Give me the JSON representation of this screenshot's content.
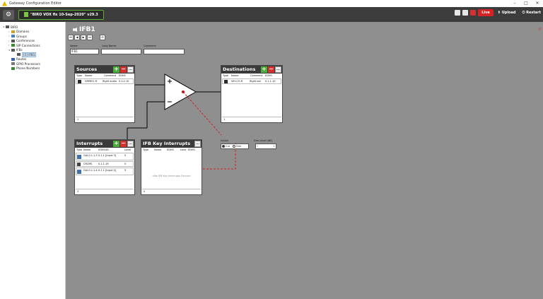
{
  "window": {
    "title": "Gateway Configuration Editor",
    "controls": [
      "–",
      "□",
      "✕"
    ]
  },
  "toolbar": {
    "file_label": "\"BIRO VOX fix 10-Sep-2020\"  v29.3",
    "live_label": "Live",
    "upload_label": "Upload",
    "restart_label": "Restart"
  },
  "tree": {
    "items": [
      {
        "label": "BIRO",
        "indent": 0,
        "icon": "system-icon",
        "color": "#555555"
      },
      {
        "label": "Domains",
        "indent": 1,
        "icon": "domains-icon",
        "color": "#c9a227"
      },
      {
        "label": "Groups",
        "indent": 1,
        "icon": "groups-icon",
        "color": "#4a7fbf"
      },
      {
        "label": "Conferences",
        "indent": 1,
        "icon": "conferences-icon",
        "color": "#555555"
      },
      {
        "label": "SIP Connections",
        "indent": 1,
        "icon": "sip-icon",
        "color": "#3a8a3a"
      },
      {
        "label": "IFBs",
        "indent": 1,
        "icon": "ifb-icon",
        "color": "#555555"
      },
      {
        "label": "[1] IFB1",
        "indent": 2,
        "icon": "ifb-item-icon",
        "color": "#555555",
        "selected": true
      },
      {
        "label": "Routes",
        "indent": 1,
        "icon": "routes-icon",
        "color": "#3a5fa8"
      },
      {
        "label": "GPIO Processors",
        "indent": 1,
        "icon": "gpio-icon",
        "color": "#777777"
      },
      {
        "label": "Phone Numbers",
        "indent": 1,
        "icon": "phone-icon",
        "color": "#3a8a3a"
      }
    ]
  },
  "page": {
    "title": "IFB1",
    "close": "✕",
    "nav": [
      "⏮",
      "◀",
      "▶",
      "⏭",
      " ",
      "⟳"
    ],
    "name_label": "Name:",
    "name_value": "IFB1",
    "long_name_label": "Long Name:",
    "long_name_value": "",
    "comment_label": "Comment:",
    "comment_value": ""
  },
  "sources": {
    "title": "Sources",
    "headers": [
      "Type",
      "Name",
      "Comment",
      "EDHS"
    ],
    "rows": [
      {
        "name": "VMMEO-R",
        "comment": "Right audio",
        "edhs": "0.1.2.10"
      }
    ],
    "count": "1"
  },
  "destinations": {
    "title": "Destinations",
    "headers": [
      "Type",
      "Name",
      "Comment",
      "EDHS"
    ],
    "rows": [
      {
        "name": "VIH-CO-R",
        "comment": "Right ear",
        "edhs": "0.1.1.10"
      }
    ],
    "count": "1"
  },
  "interrupts": {
    "title": "Interrupts",
    "headers": [
      "Type",
      "Name",
      "EDHS/ID",
      "Level"
    ],
    "rows": [
      {
        "name": "GAI-0.1.1.3",
        "edhs": "0.1.1 [Input 3]",
        "level": "5"
      },
      {
        "name": "CRCMS",
        "edhs": "0.1.1.19",
        "level": "5"
      },
      {
        "name": "GAI-0.1.1.4",
        "edhs": "0.1.1 [Input 4]",
        "level": "5"
      }
    ],
    "count": "3"
  },
  "ifb_key": {
    "title": "IFB Key Interrupts",
    "headers": [
      "Type",
      "Name",
      "EDHS",
      "Leve",
      "EDHS"
    ],
    "empty": "<No IFB Key Interrupts Found>",
    "count": "0"
  },
  "action": {
    "label": "Action",
    "cut": "Cut",
    "dim": "Dim",
    "dim_level_label": "Dim Level (dB)",
    "dim_level_value": "0"
  }
}
